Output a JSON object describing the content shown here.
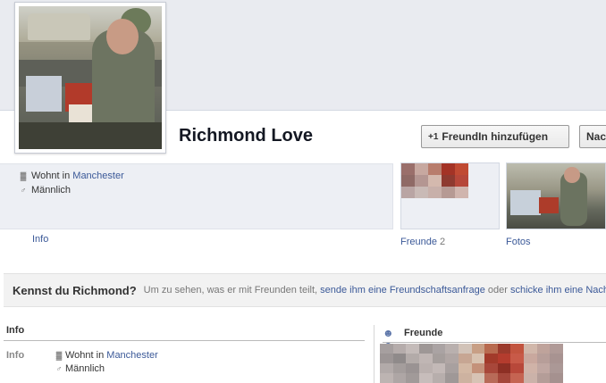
{
  "profile": {
    "name": "Richmond Love",
    "lives_in_prefix": "Wohnt in",
    "lives_in_city": "Manchester",
    "gender": "Männlich"
  },
  "actions": {
    "add_friend_label": "FreundIn hinzufügen",
    "add_friend_icon": "+1",
    "message_label": "Nac"
  },
  "tabs": {
    "info_label": "Info",
    "friends_label": "Freunde",
    "friends_count": "2",
    "photos_label": "Fotos"
  },
  "know_bar": {
    "title": "Kennst du Richmond?",
    "text_prefix": "Um zu sehen, was er mit Freunden teilt,",
    "link_request": "sende ihm eine Freundschaftsanfrage",
    "text_or": "oder",
    "link_message": "schicke ihm eine Nachric"
  },
  "info_section": {
    "heading": "Info",
    "label": "Info"
  },
  "friends_section": {
    "heading": "Freunde"
  },
  "icons": {
    "home": "home-icon",
    "gender": "male-icon",
    "friends": "friends-icon"
  },
  "colors": {
    "link": "#3b5998",
    "cover": "#e9ebf0",
    "info_box": "#edeff4"
  }
}
